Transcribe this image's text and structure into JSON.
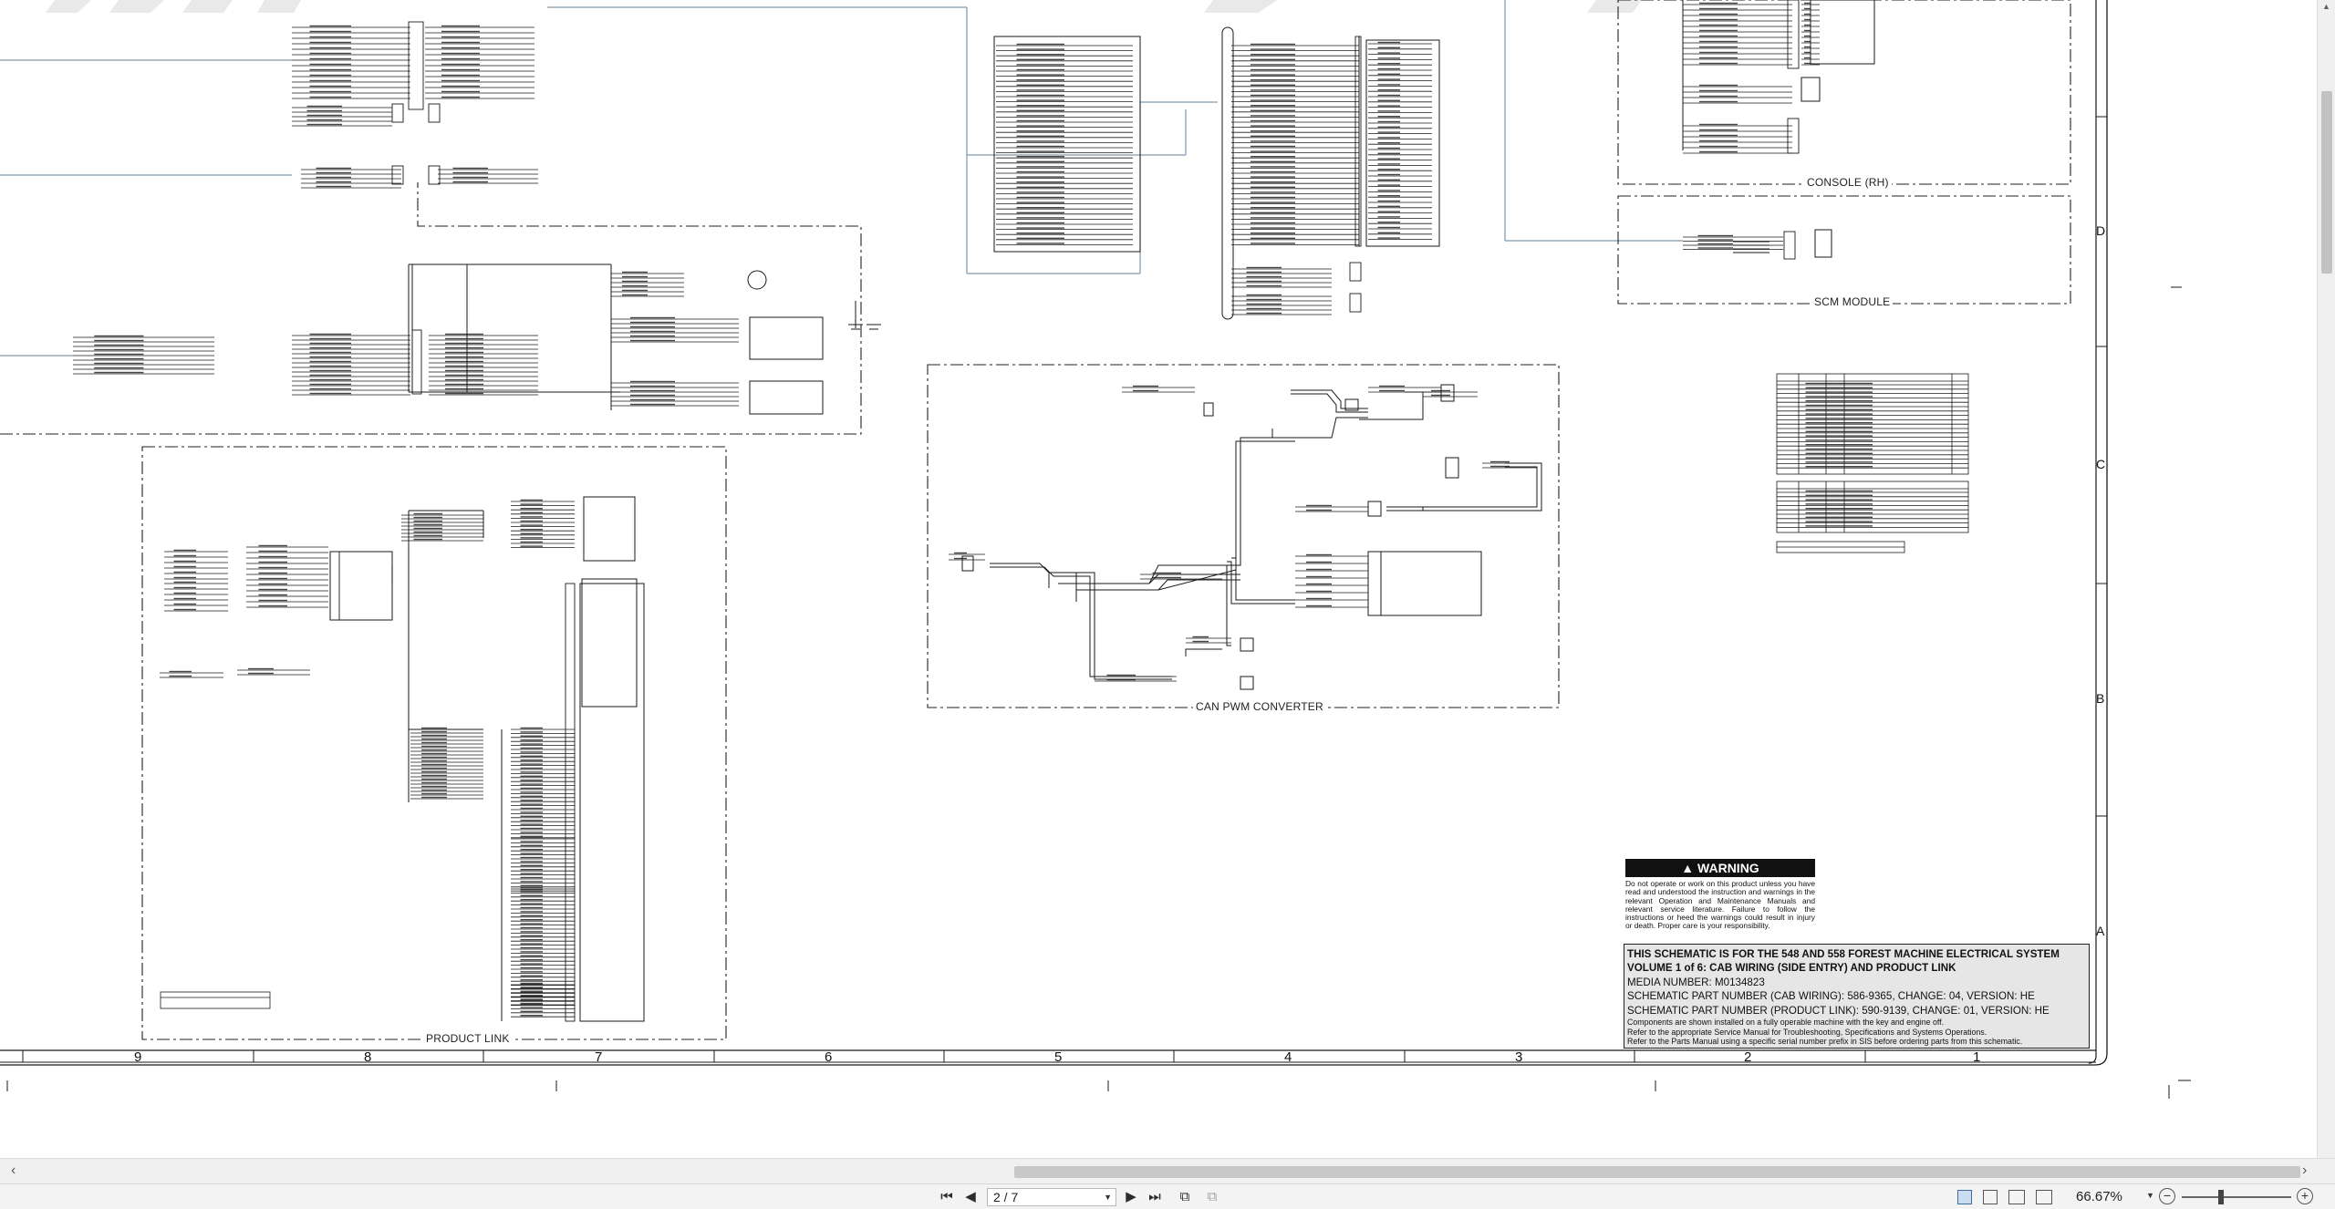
{
  "schematic": {
    "sections": {
      "console_rh": "CONSOLE (RH)",
      "scm_module": "SCM MODULE",
      "can_pwm": "CAN PWM CONVERTER",
      "product_link": "PRODUCT LINK"
    },
    "zone_columns": [
      "9",
      "8",
      "7",
      "6",
      "5",
      "4",
      "3",
      "2",
      "1"
    ],
    "zone_rows": [
      "D",
      "C",
      "B",
      "A"
    ],
    "warning": {
      "title": "WARNING",
      "body": "Do not operate or work on this product unless you have read and understood the instruction and warnings in the relevant Operation and Maintenance Manuals and relevant service literature. Failure to follow the instructions or heed the warnings could result in injury or death. Proper care is your responsibility."
    },
    "title_block": {
      "line1": "THIS SCHEMATIC IS FOR THE 548 AND 558 FOREST MACHINE ELECTRICAL SYSTEM",
      "line2": "VOLUME 1 of 6: CAB WIRING (SIDE ENTRY) AND PRODUCT LINK",
      "line3": "MEDIA NUMBER: M0134823",
      "line4": "SCHEMATIC PART NUMBER (CAB WIRING): 586-9365, CHANGE: 04, VERSION: HE",
      "line5": "SCHEMATIC PART NUMBER (PRODUCT LINK): 590-9139, CHANGE: 01, VERSION: HE",
      "note1": "Components are shown installed on a fully operable machine with the key and engine off.",
      "note2": "Refer to the appropriate Service Manual for Troubleshooting, Specifications and Systems Operations.",
      "note3": "Refer to the Parts Manual using a specific serial number prefix in SIS before ordering parts from this schematic."
    }
  },
  "statusbar": {
    "page_value": "2 / 7",
    "zoom": "66.67%"
  },
  "colors": {
    "wire": "#1a1a1a",
    "harness": "#7f97ad",
    "titleblock_bg": "#e6e6e6",
    "chrome_bg": "#f3f3f3"
  },
  "icons": [
    "first-page-icon",
    "previous-page-icon",
    "next-page-icon",
    "last-page-icon",
    "previous-view-icon",
    "next-view-icon",
    "single-page-icon",
    "continuous-icon",
    "two-page-icon",
    "two-page-continuous-icon",
    "zoom-out-icon",
    "zoom-in-icon"
  ]
}
